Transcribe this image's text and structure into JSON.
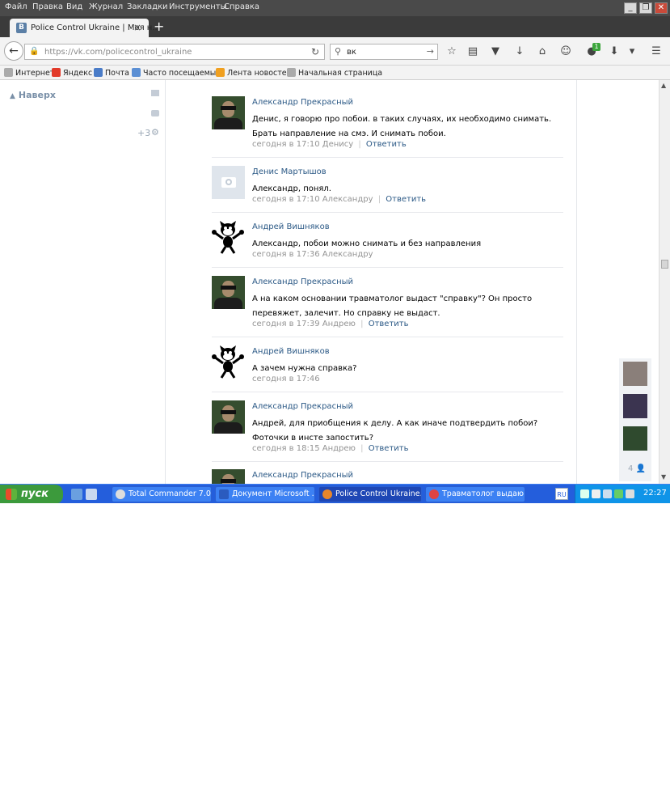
{
  "menu": [
    "Файл",
    "Правка",
    "Вид",
    "Журнал",
    "Закладки",
    "Инструменты",
    "Справка"
  ],
  "window_controls": {
    "minimize": "_",
    "restore": "❐",
    "close": "✕"
  },
  "tab": {
    "icon": "B",
    "title": "Police Control Ukraine | Моя н..."
  },
  "address": {
    "host": "https://vk.com/policecontrol_ukraine"
  },
  "search": {
    "value": "вк"
  },
  "toolbar_icons": [
    "star-icon",
    "reading-list-icon",
    "pocket-icon",
    "download-icon",
    "home-icon",
    "chat-icon",
    "addon-icon",
    "download-arrow-icon",
    "dropdown-icon",
    "menu-icon"
  ],
  "addon_badge": "1",
  "bookmarks": [
    "Интернет",
    "Яндекс",
    "Почта",
    "Часто посещаемые",
    "Лента новостей",
    "Начальная страница"
  ],
  "sidebar": {
    "up_label": "Наверх",
    "more_count": "+3"
  },
  "comments": [
    {
      "name": "Александр Прекрасный",
      "text": "Денис, я говорю про побои. в таких случаях, их необходимо снимать. Брать направление на смэ. И снимать побои.",
      "time": "сегодня в 17:10",
      "to": "Денису",
      "reply": "Ответить",
      "avatar": "agent"
    },
    {
      "name": "Денис Мартышов",
      "text": "Александр, понял.",
      "time": "сегодня в 17:10",
      "to": "Александру",
      "reply": "Ответить",
      "avatar": "camera"
    },
    {
      "name": "Андрей Вишняков",
      "text": "Александр, побои можно снимать и без направления",
      "time": "сегодня в 17:36",
      "to": "Александру",
      "reply": "",
      "avatar": "cat"
    },
    {
      "name": "Александр Прекрасный",
      "text": "А на каком основании травматолог выдаст \"справку\"? Он просто перевяжет, залечит. Но справку не выдаст.",
      "time": "сегодня в 17:39",
      "to": "Андрею",
      "reply": "Ответить",
      "avatar": "agent"
    },
    {
      "name": "Андрей Вишняков",
      "text": "А зачем нужна справка?",
      "time": "сегодня в 17:46",
      "to": "",
      "reply": "",
      "avatar": "cat"
    },
    {
      "name": "Александр Прекрасный",
      "text": "Андрей, для приобщения к делу. А как иначе подтвердить побои? Фоточки в инсте запостить?",
      "time": "сегодня в 18:15",
      "to": "Андрею",
      "reply": "Ответить",
      "avatar": "agent"
    },
    {
      "name": "Александр Прекрасный",
      "text": "",
      "time": "",
      "to": "",
      "reply": "",
      "avatar": "agent"
    }
  ],
  "friends_panel": {
    "count": "4"
  },
  "taskbar": {
    "start_label": "пуск",
    "tasks": [
      "Total Commander 7.0...",
      "Документ Microsoft ...",
      "Police Control Ukraine...",
      "Травматолог выдаю..."
    ],
    "lang": "RU",
    "clock": "22:27"
  }
}
